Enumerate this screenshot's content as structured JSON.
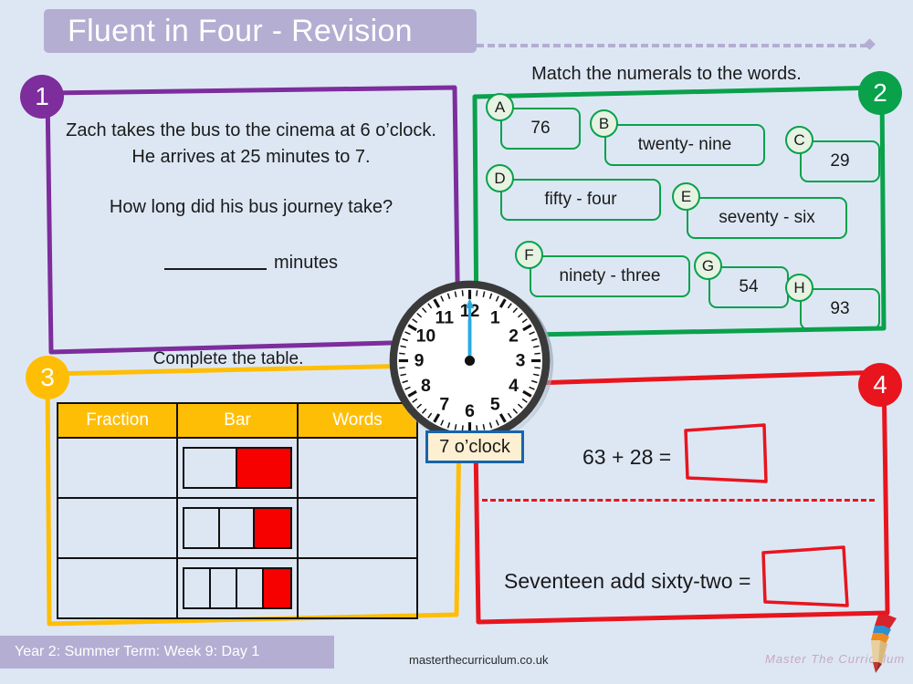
{
  "header": {
    "title": "Fluent in Four - Revision",
    "band_color": "#b3aed2"
  },
  "colors": {
    "background": "#dde7f4",
    "q1_purple": "#7d2d9c",
    "q2_green": "#0aa14b",
    "q3_amber": "#ffbe06",
    "q4_red": "#e8151e",
    "bar_fill_red": "#f70000",
    "clock_hand_blue": "#29abe2",
    "label_cream": "#fdf0d2",
    "label_border_blue": "#1565ad"
  },
  "q1": {
    "number": "1",
    "line1": "Zach takes the bus to the cinema at 6 o’clock.",
    "line2": "He arrives at 25 minutes to 7.",
    "line3": "How long did his bus journey take?",
    "answer_unit": "minutes"
  },
  "q2": {
    "number": "2",
    "heading": "Match the numerals to the words.",
    "items": [
      {
        "letter": "A",
        "text": "76"
      },
      {
        "letter": "B",
        "text": "twenty- nine"
      },
      {
        "letter": "C",
        "text": "29"
      },
      {
        "letter": "D",
        "text": "fifty - four"
      },
      {
        "letter": "E",
        "text": "seventy - six"
      },
      {
        "letter": "F",
        "text": "ninety - three"
      },
      {
        "letter": "G",
        "text": "54"
      },
      {
        "letter": "H",
        "text": "93"
      }
    ]
  },
  "q3": {
    "number": "3",
    "heading": "Complete the table.",
    "columns": [
      "Fraction",
      "Bar",
      "Words"
    ],
    "rows": [
      {
        "fraction": "",
        "bar_parts": 2,
        "bar_shaded": 1,
        "words": ""
      },
      {
        "fraction": "",
        "bar_parts": 3,
        "bar_shaded": 1,
        "words": ""
      },
      {
        "fraction": "",
        "bar_parts": 4,
        "bar_shaded": 1,
        "words": ""
      }
    ]
  },
  "q4": {
    "number": "4",
    "problem1": "63 + 28 =",
    "problem2": "Seventeen add sixty-two =",
    "answer1": "",
    "answer2": ""
  },
  "clock": {
    "hour_hand_position": "12",
    "minute_hand_position": "12",
    "numerals": [
      "12",
      "1",
      "2",
      "3",
      "4",
      "5",
      "6",
      "7",
      "8",
      "9",
      "10",
      "11"
    ],
    "label": "7 o’clock"
  },
  "footer": {
    "lesson_info": "Year 2: Summer Term: Week 9: Day 1",
    "website": "masterthecurriculum.co.uk",
    "brand": "Master The Curriculum"
  }
}
